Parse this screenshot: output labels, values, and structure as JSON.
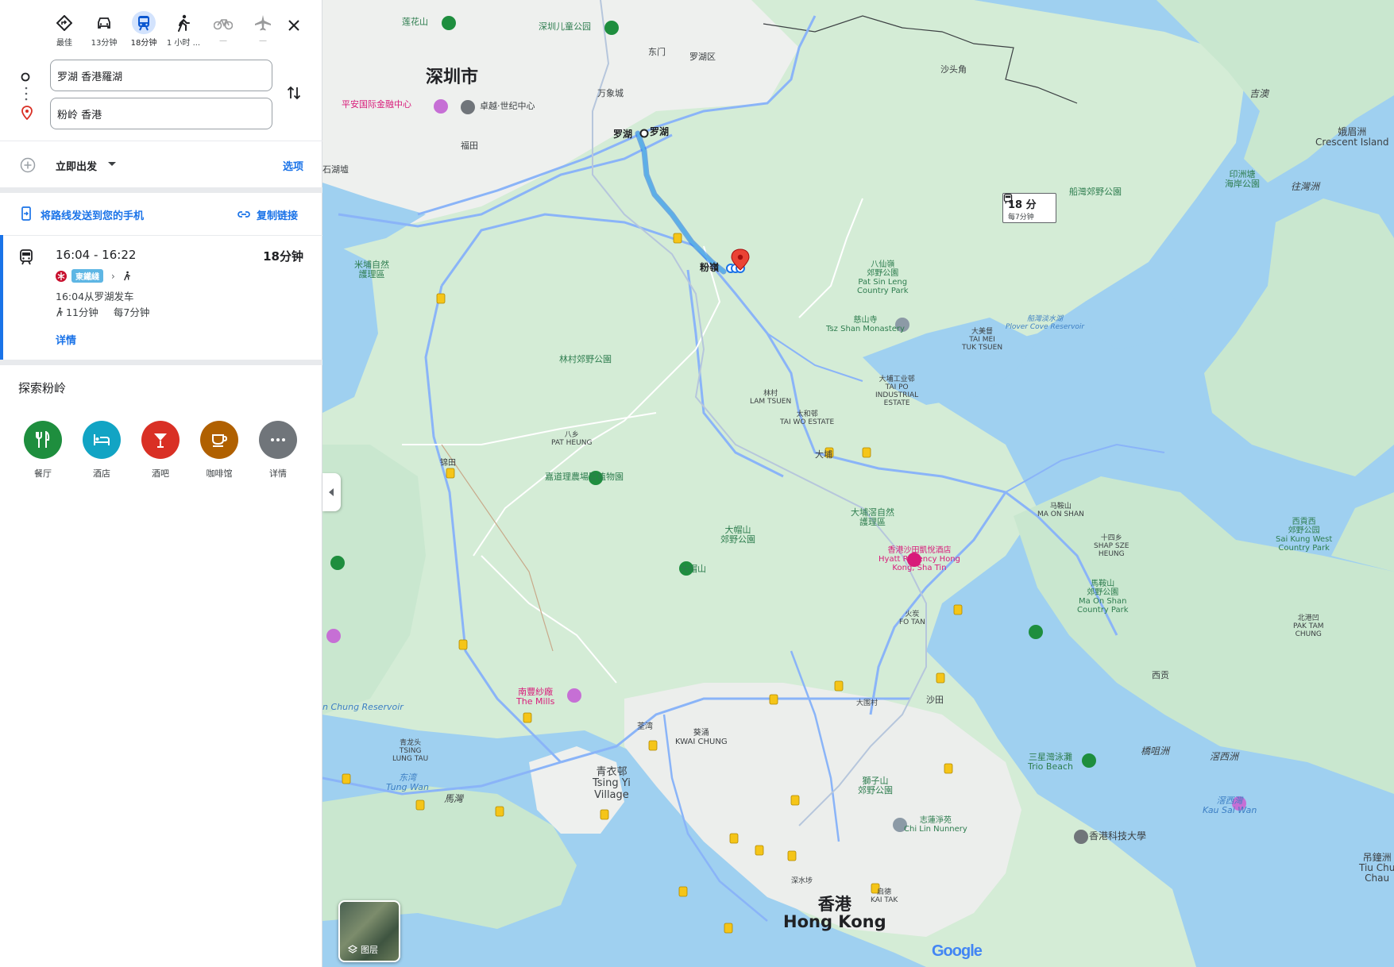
{
  "modes": [
    {
      "label": "最佳",
      "icon": "diamond-directions-icon"
    },
    {
      "label": "13分钟",
      "icon": "car-icon"
    },
    {
      "label": "18分钟",
      "icon": "train-icon",
      "active": true
    },
    {
      "label": "1 小时 ...",
      "icon": "walk-icon"
    },
    {
      "label": "—",
      "icon": "bicycle-icon"
    },
    {
      "label": "—",
      "icon": "plane-icon"
    }
  ],
  "origin": "罗湖 香港羅湖",
  "destination": "粉岭 香港",
  "depart": {
    "label": "立即出发",
    "options": "选项"
  },
  "share": {
    "send": "将路线发送到您的手机",
    "copy": "复制链接"
  },
  "route": {
    "times": "16:04 - 16:22",
    "duration": "18分钟",
    "line": "東鐵綫",
    "departure_info": "16:04从罗湖发车",
    "walk": "11分钟",
    "frequency": "每7分钟",
    "details": "详情"
  },
  "explore": {
    "title": "探索粉岭",
    "categories": [
      {
        "label": "餐厅",
        "color": "#1e8e3e",
        "icon": "restaurant-icon"
      },
      {
        "label": "酒店",
        "color": "#12a4c4",
        "icon": "hotel-icon"
      },
      {
        "label": "酒吧",
        "color": "#d93025",
        "icon": "bar-icon"
      },
      {
        "label": "咖啡馆",
        "color": "#b06000",
        "icon": "cafe-icon"
      },
      {
        "label": "详情",
        "color": "#70757a",
        "icon": "more-icon"
      }
    ]
  },
  "map": {
    "transit_box": {
      "time": "18 分",
      "freq": "每7分钟"
    },
    "layers": "图层",
    "logo": "Google",
    "labels": {
      "shenzhen": "深圳市",
      "luohu_a": "罗湖",
      "luohu_b": "罗湖",
      "fanling": "粉嶺",
      "lianhuashan": "莲花山",
      "childpark": "深圳儿童公园",
      "dongmen": "东门",
      "luohuqu": "罗湖区",
      "pingan": "平安国际金融中心",
      "zhuoyue": "卓越·世纪中心",
      "futian": "福田",
      "shatoujiao": "沙头角",
      "mipu": "米埔自然\n護理區",
      "lamtsuen_park": "林村郊野公園",
      "patsinleng": "八仙嶺\n郊野公園\nPat Sin Leng\nCountry Park",
      "tszshan": "慈山寺\nTsz Shan Monastery",
      "taimei": "大美督\nTAI MEI\nTUK TSUEN",
      "plover": "船灣淡水湖\nPlover Cove Reservoir",
      "plovercove_park": "船灣郊野公園",
      "yinzhou": "印洲塘\n海岸公園",
      "crescent": "娥眉洲\nCrescent Island",
      "wangjichow": "往灣洲",
      "jiyi": "吉澳",
      "taipo_ind": "大埔工业邨\nTAI PO\nINDUSTRIAL\nESTATE",
      "lamtsuen": "林村\nLAM TSUEN",
      "taiwo": "太和邨\nTAI WO ESTATE",
      "taipo": "大埔",
      "patheung": "八乡\nPAT HEUNG",
      "kadoorie": "嘉道理農場暨植物園",
      "taimoshan_park": "大帽山\n郊野公園",
      "taimoshan": "大帽山",
      "taipokau": "大埔滘自然\n護理區",
      "hyatt": "香港沙田凱悅酒店\nHyatt Regency Hong\nKong, Sha Tin",
      "maonshan": "马鞍山\nMA ON SHAN",
      "shapsze": "十四乡\nSHAP SZE\nHEUNG",
      "maonshan_park": "馬鞍山\n郊野公園\nMa On Shan\nCountry Park",
      "saikung_west": "西貢西\n郊野公园\nSai Kung West\nCountry Park",
      "pakshatam": "北港凹\nPAK TAM\nCHUNG",
      "saikung": "西贡",
      "fotan": "火炭\nFO TAN",
      "shatin": "沙田",
      "taiwai": "大围村",
      "kwaichung": "葵涌\nKWAI CHUNG",
      "tsuenwan": "荃湾",
      "themills": "南豐紗廠\nThe Mills",
      "tsingyi": "青衣邨\nTsing Yi\nVillage",
      "tsinglungtau": "青龙头\nTSING\nLUNG TAU",
      "tungwan": "东湾\nTung Wan",
      "mawan": "馬灣",
      "lionrock": "獅子山\n郊野公園",
      "chilin": "志蓮淨苑\nChi Lin Nunnery",
      "hkust": "香港科技大學",
      "triobeach": "三星灣泳灘\nTrio Beach",
      "kausaiwan": "滘西灣\nKau Sai Wan",
      "kaumaichau": "橋咀洲",
      "kauchau": "滘西洲",
      "hongkong": "香港\nHong Kong",
      "kaitak": "启德\nKAI TAK",
      "shuipo": "深水埗",
      "tiuchung": "吊鐘洲\nTiu Chu\nChau",
      "chungreservoir": "n Chung Reservoir",
      "shekwu": "石湖墟",
      "jintian": "锦田",
      "wanhua": "万象城"
    }
  }
}
